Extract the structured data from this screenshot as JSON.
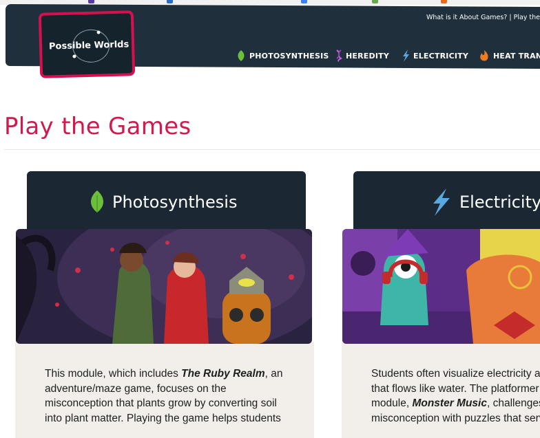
{
  "site": {
    "logo_text": "Possible Worlds",
    "top_links": "What is it About Games? | Play the G"
  },
  "nav": {
    "items": [
      {
        "label": "PHOTOSYNTHESIS",
        "icon": "leaf-icon"
      },
      {
        "label": "HEREDITY",
        "icon": "dna-icon"
      },
      {
        "label": "ELECTRICITY",
        "icon": "lightning-icon"
      },
      {
        "label": "HEAT TRANS",
        "icon": "flame-icon"
      }
    ]
  },
  "page": {
    "title": "Play the Games"
  },
  "cards": [
    {
      "title": "Photosynthesis",
      "icon": "leaf-icon",
      "image": "ruby-realm-illustration",
      "text": {
        "l1a": "This module, which includes ",
        "l1b": "The Ruby Realm",
        "l1c": ", an",
        "l2": "adventure/maze game, focuses on the",
        "l3": "misconception that plants grow by converting soil",
        "l4": "into plant matter. Playing the game helps students"
      }
    },
    {
      "title": "Electricity",
      "icon": "lightning-icon",
      "image": "monster-music-illustration",
      "text": {
        "l1": "Students often visualize electricity as",
        "l2": "that flows like water. The platformer",
        "l3a": "module, ",
        "l3b": "Monster Music",
        "l3c": ", challenges",
        "l4": "misconception with puzzles that serv"
      }
    }
  ],
  "colors": {
    "header_bg": "#1f2f3c",
    "accent": "#cf1a4e",
    "leaf_green": "#6abf3b",
    "bolt_blue": "#5aa8e0",
    "card_body": "#f2eee9"
  }
}
